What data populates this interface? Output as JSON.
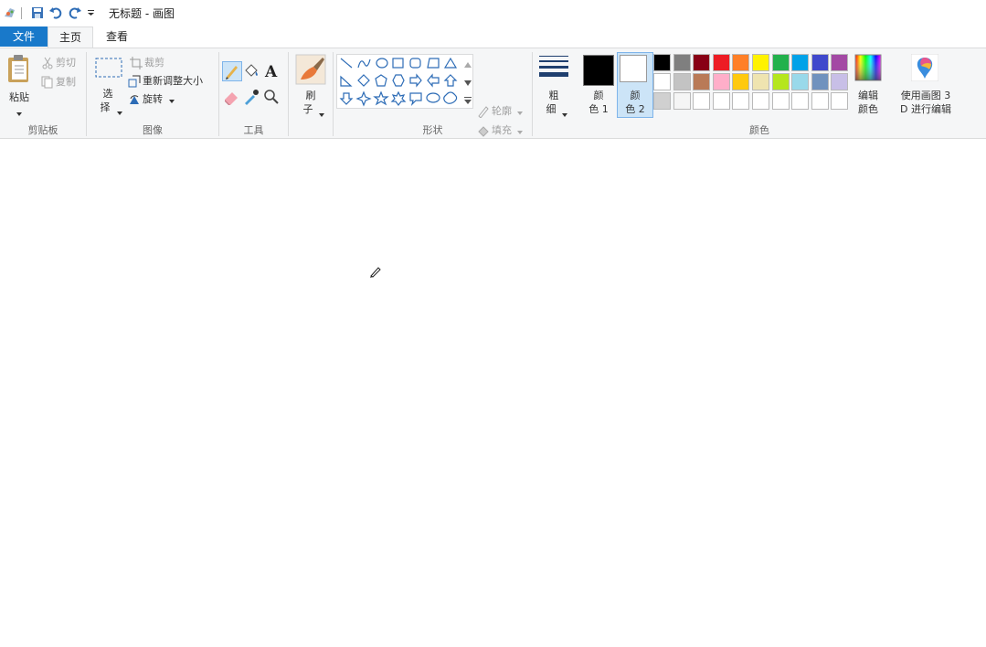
{
  "window": {
    "title": "无标题 - 画图"
  },
  "tabs": {
    "file": "文件",
    "home": "主页",
    "view": "查看"
  },
  "clipboard": {
    "paste": "粘贴",
    "cut": "剪切",
    "copy": "复制",
    "group_label": "剪贴板"
  },
  "image": {
    "select_line1": "选",
    "select_line2": "择",
    "crop": "裁剪",
    "resize": "重新调整大小",
    "rotate": "旋转",
    "group_label": "图像"
  },
  "tools": {
    "group_label": "工具"
  },
  "brushes": {
    "label_line1": "刷",
    "label_line2": "子",
    "group_label": ""
  },
  "shapes": {
    "outline": "轮廓",
    "fill": "填充",
    "group_label": "形状"
  },
  "size": {
    "label_line1": "粗",
    "label_line2": "细"
  },
  "colors": {
    "color1_line1": "颜",
    "color1_line2": "色 1",
    "color2_line1": "颜",
    "color2_line2": "色 2",
    "edit_line1": "编辑",
    "edit_line2": "颜色",
    "paint3d_line1": "使用画图 3",
    "paint3d_line2": "D 进行编辑",
    "group_label": "颜色",
    "color1_value": "#000000",
    "color2_value": "#ffffff",
    "palette_row1": [
      "#000000",
      "#7f7f7f",
      "#880015",
      "#ed1c24",
      "#ff7f27",
      "#fff200",
      "#22b14c",
      "#00a2e8",
      "#3f48cc",
      "#a349a4"
    ],
    "palette_row2": [
      "#ffffff",
      "#c3c3c3",
      "#b97a57",
      "#ffaec9",
      "#ffc90e",
      "#efe4b0",
      "#b5e61d",
      "#99d9ea",
      "#7092be",
      "#c8bfe7"
    ],
    "palette_row3": [
      "#d0d0d0",
      "#f5f5f5",
      "#ffffff",
      "#ffffff",
      "#ffffff",
      "#ffffff",
      "#ffffff",
      "#ffffff",
      "#ffffff",
      "#ffffff"
    ]
  }
}
